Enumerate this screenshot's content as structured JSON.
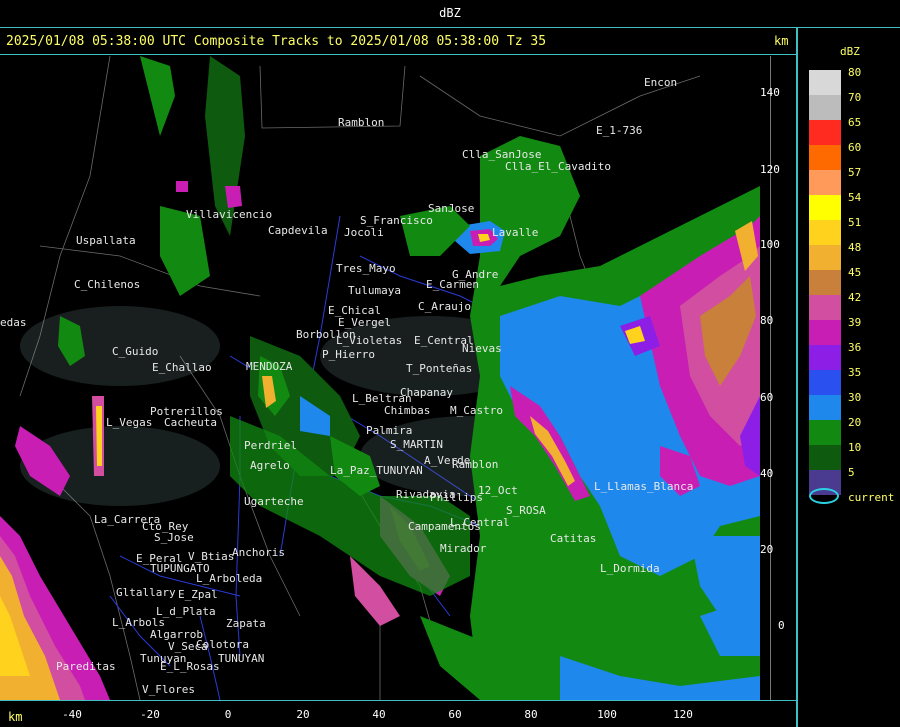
{
  "window": {
    "title": "dBZ"
  },
  "header": {
    "text": "2025/01/08 05:38:00 UTC Composite Tracks to 2025/01/08 05:38:00 Tz 35",
    "km_label": "km"
  },
  "axes": {
    "x_ticks": [
      "-40",
      "-20",
      "0",
      "20",
      "40",
      "60",
      "80",
      "100",
      "120"
    ],
    "y_ticks": [
      "140",
      "120",
      "100",
      "80",
      "60",
      "40",
      "20",
      "0"
    ],
    "bottom_km": "km"
  },
  "legend": {
    "title": "dBZ",
    "entries": [
      {
        "value": "80",
        "color": "#d8d8d8"
      },
      {
        "value": "70",
        "color": "#bcbcbc"
      },
      {
        "value": "65",
        "color": "#ff2a20"
      },
      {
        "value": "60",
        "color": "#ff6a00"
      },
      {
        "value": "57",
        "color": "#ff9a5a"
      },
      {
        "value": "54",
        "color": "#ffff00"
      },
      {
        "value": "51",
        "color": "#ffd21e"
      },
      {
        "value": "48",
        "color": "#f2b030"
      },
      {
        "value": "45",
        "color": "#c8803a"
      },
      {
        "value": "42",
        "color": "#d24ea0"
      },
      {
        "value": "39",
        "color": "#c81eb4"
      },
      {
        "value": "36",
        "color": "#8c1ee6"
      },
      {
        "value": "35",
        "color": "#2a50f0"
      },
      {
        "value": "30",
        "color": "#1e88ec"
      },
      {
        "value": "20",
        "color": "#128a12"
      },
      {
        "value": "10",
        "color": "#0e5a0e"
      },
      {
        "value": "5",
        "color": "#4a3a90"
      }
    ],
    "current_label": "current",
    "current_color": "#2ad0e0"
  },
  "places": [
    {
      "name": "Ramblon"
    },
    {
      "name": "Encon"
    },
    {
      "name": "E_1-736"
    },
    {
      "name": "Clla_SanJose"
    },
    {
      "name": "Clla_El_Cavadito"
    },
    {
      "name": "S_Francisco"
    },
    {
      "name": "SanJose"
    },
    {
      "name": "Uspallata"
    },
    {
      "name": "Villavicencio"
    },
    {
      "name": "Capdevila"
    },
    {
      "name": "Jocoli"
    },
    {
      "name": "Lavalle"
    },
    {
      "name": "Tres_Mayo"
    },
    {
      "name": "G_Andre"
    },
    {
      "name": "Tulumaya"
    },
    {
      "name": "E_Carmen"
    },
    {
      "name": "C_Chilenos"
    },
    {
      "name": "E_Chical"
    },
    {
      "name": "C_Araujo"
    },
    {
      "name": "E_Vergel"
    },
    {
      "name": "Borbollon"
    },
    {
      "name": "L_Violetas"
    },
    {
      "name": "E_Central"
    },
    {
      "name": "Nievas"
    },
    {
      "name": "C_Guido"
    },
    {
      "name": "P_Hierro"
    },
    {
      "name": "E_Challao"
    },
    {
      "name": "MENDOZA"
    },
    {
      "name": "T_Ponteñas"
    },
    {
      "name": "Chapanay"
    },
    {
      "name": "L_Beltran"
    },
    {
      "name": "Potrerillos"
    },
    {
      "name": "Chimbas"
    },
    {
      "name": "M_Castro"
    },
    {
      "name": "L_Vegas"
    },
    {
      "name": "Cacheuta"
    },
    {
      "name": "Palmira"
    },
    {
      "name": "Perdriel"
    },
    {
      "name": "S_MARTIN"
    },
    {
      "name": "Agrelo"
    },
    {
      "name": "A_Verde"
    },
    {
      "name": "Ramblon"
    },
    {
      "name": "La_Paz_TUNUYAN"
    },
    {
      "name": "Ugarteche"
    },
    {
      "name": "Rivadavia"
    },
    {
      "name": "Phillips"
    },
    {
      "name": "12_Oct"
    },
    {
      "name": "La_Carrera"
    },
    {
      "name": "S_ROSA"
    },
    {
      "name": "Cto_Rey"
    },
    {
      "name": "Campamentos"
    },
    {
      "name": "L_Central"
    },
    {
      "name": "S_Jose"
    },
    {
      "name": "Mirador"
    },
    {
      "name": "Catitas"
    },
    {
      "name": "Anchoris"
    },
    {
      "name": "E_Peral"
    },
    {
      "name": "V_Btias"
    },
    {
      "name": "TUPUNGATO"
    },
    {
      "name": "L_Arboleda"
    },
    {
      "name": "L_Dormida"
    },
    {
      "name": "Gltallary"
    },
    {
      "name": "E_Zpal"
    },
    {
      "name": "L_d_Plata"
    },
    {
      "name": "L_Arbols"
    },
    {
      "name": "Zapata"
    },
    {
      "name": "Algarrob"
    },
    {
      "name": "V_Seca"
    },
    {
      "name": "Colotora"
    },
    {
      "name": "Tunuyan"
    },
    {
      "name": "E_L_Rosas"
    },
    {
      "name": "TUNUYAN"
    },
    {
      "name": "Pareditas"
    },
    {
      "name": "V_Flores"
    },
    {
      "name": "L_Llamas_Blanca"
    },
    {
      "name": "edas"
    }
  ]
}
